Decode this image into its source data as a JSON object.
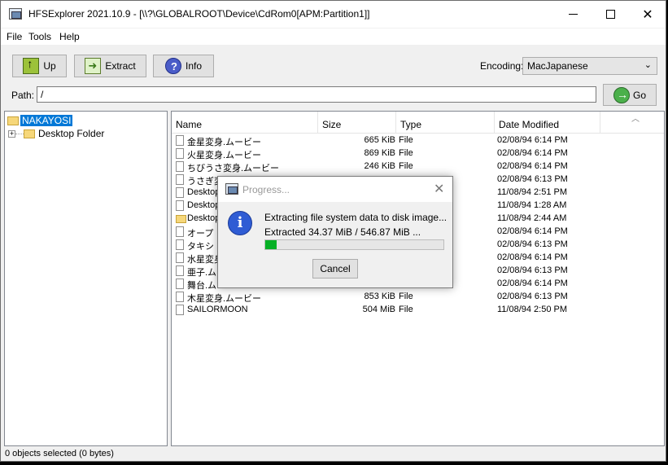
{
  "window": {
    "title": "HFSExplorer 2021.10.9 - [\\\\?\\GLOBALROOT\\Device\\CdRom0[APM:Partition1]]",
    "minimize": "",
    "maximize": "",
    "close": "✕"
  },
  "menu": [
    "File",
    "Tools",
    "Help"
  ],
  "toolbar": {
    "up_label": "Up",
    "extract_label": "Extract",
    "info_label": "Info",
    "encoding_label": "Encoding:",
    "encoding_value": "MacJapanese"
  },
  "path": {
    "label": "Path:",
    "value": "/",
    "go_label": "Go"
  },
  "tree": {
    "root": "NAKAYOSI",
    "child": "Desktop Folder"
  },
  "list": {
    "columns": [
      "Name",
      "Size",
      "Type",
      "Date Modified"
    ],
    "rows": [
      {
        "name": "金星変身.ムービー",
        "size": "665 KiB",
        "type": "File",
        "date": "02/08/94 6:14 PM"
      },
      {
        "name": "火星変身.ムービー",
        "size": "869 KiB",
        "type": "File",
        "date": "02/08/94 6:14 PM"
      },
      {
        "name": "ちびうさ変身.ムービー",
        "size": "246 KiB",
        "type": "File",
        "date": "02/08/94 6:14 PM"
      },
      {
        "name": "うさぎ変身",
        "size": "",
        "type": "",
        "date": "02/08/94 6:13 PM"
      },
      {
        "name": "Desktop",
        "size": "",
        "type": "",
        "date": "11/08/94 2:51 PM"
      },
      {
        "name": "Desktop",
        "size": "",
        "type": "",
        "date": "11/08/94 1:28 AM"
      },
      {
        "name": "Desktop",
        "size": "",
        "type": "",
        "date": "11/08/94 2:44 AM"
      },
      {
        "name": "オープ",
        "size": "",
        "type": "",
        "date": "02/08/94 6:14 PM"
      },
      {
        "name": "タキシ",
        "size": "",
        "type": "",
        "date": "02/08/94 6:13 PM"
      },
      {
        "name": "水星変身",
        "size": "",
        "type": "",
        "date": "02/08/94 6:14 PM"
      },
      {
        "name": "亜子.ム",
        "size": "",
        "type": "",
        "date": "02/08/94 6:13 PM"
      },
      {
        "name": "舞台.ム",
        "size": "",
        "type": "",
        "date": "02/08/94 6:14 PM"
      },
      {
        "name": "木星変身.ムービー",
        "size": "853 KiB",
        "type": "File",
        "date": "02/08/94 6:13 PM"
      },
      {
        "name": "SAILORMOON",
        "size": "504 MiB",
        "type": "File",
        "date": "11/08/94 2:50 PM"
      }
    ]
  },
  "status": "0 objects selected (0 bytes)",
  "dialog": {
    "title": "Progress...",
    "close": "✕",
    "message": "Extracting file system data to disk image...",
    "sub": "Extracted 34.37 MiB / 546.87 MiB ...",
    "progress": 0.063,
    "cancel_label": "Cancel"
  }
}
